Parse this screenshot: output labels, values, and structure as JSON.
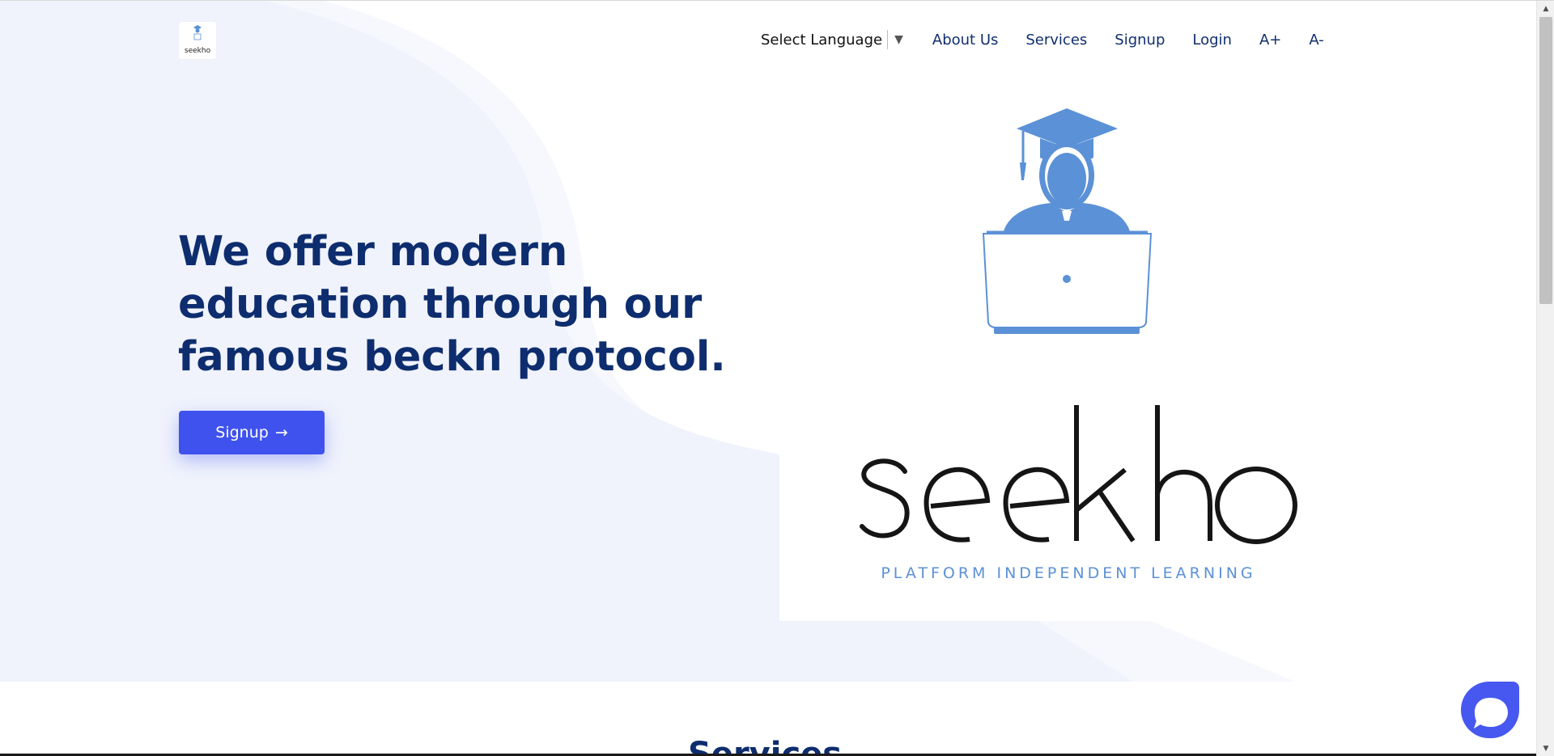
{
  "header": {
    "logo_text": "seekho",
    "language_select_label": "Select Language",
    "nav": {
      "about": "About Us",
      "services": "Services",
      "signup": "Signup",
      "login": "Login",
      "font_increase": "A+",
      "font_decrease": "A-"
    }
  },
  "hero": {
    "heading": "We offer modern education through our famous beckn protocol.",
    "signup_button": "Signup",
    "signup_arrow": "→"
  },
  "brand": {
    "wordmark": "seekho",
    "tagline": "PLATFORM INDEPENDENT LEARNING"
  },
  "section_peek": "Services",
  "colors": {
    "primary": "#3f52ee",
    "heading": "#0e2d6e",
    "nav": "#102e6e",
    "hero_bg": "#f0f3fc",
    "icon_blue": "#5b91d6"
  },
  "icons": {
    "language_caret": "▼",
    "scroll_up": "▲",
    "scroll_down": "▼"
  }
}
